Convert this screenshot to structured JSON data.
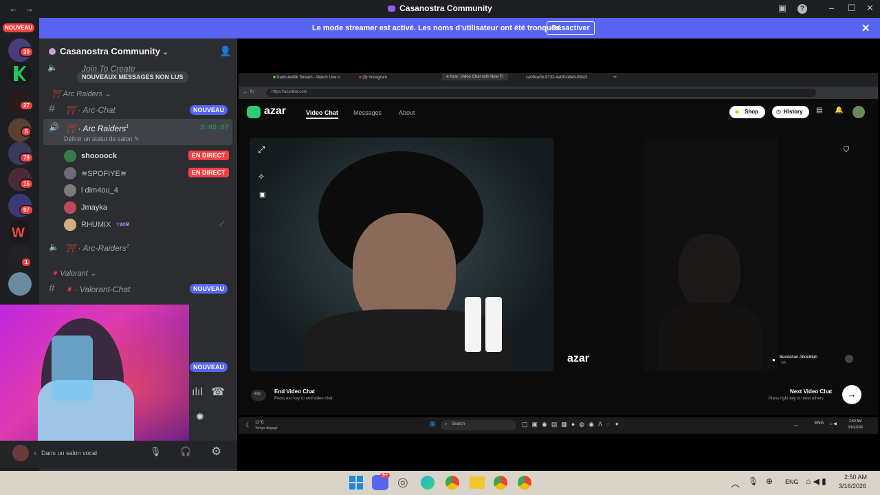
{
  "window": {
    "title": "Casanostra Community"
  },
  "banner": {
    "text": "Le mode streamer est activé. Les noms d’utilisateur ont été tronqués.",
    "button": "Désactiver"
  },
  "rail": {
    "nouveau": "NOUVEAU",
    "badges": [
      "30",
      "27",
      "5",
      "79",
      "15",
      "97",
      "1"
    ]
  },
  "sidebar": {
    "server_name": "Casanostra Community",
    "unread_pill": "NOUVEAUX MESSAGES NON LUS",
    "join_to_create": "Join To Create",
    "cat_arc": "Arc Raiders",
    "arc_chat": "Arc-Chat",
    "arc_chat_badge": "NOUVEAU",
    "voice_channel": "Arc Raiders",
    "voice_sup": "1",
    "voice_timer": "3:05:07",
    "voice_status": "Définir un statut de salon",
    "users": [
      {
        "name": "shoooock",
        "badge": "EN DIRECT"
      },
      {
        "name": "≋SPOFIYE≋",
        "badge": "EN DIRECT"
      },
      {
        "name": "l dim4ou_4",
        "badge": ""
      },
      {
        "name": "Jmayka",
        "badge": ""
      },
      {
        "name": "RHUMIX",
        "badge": ""
      }
    ],
    "arc_raiders2": "Arc-Raiders",
    "arc_raiders2_sup": "2",
    "cat_valorant": "Valorant",
    "valorant_chat": "Valorant-Chat",
    "valorant_badge": "NOUVEAU",
    "lower_badge": "NOUVEAU"
  },
  "userbar": {
    "status": "Dans un salon vocal"
  },
  "share": {
    "tabs": [
      "Nahouliel9k Stream - Watch Live o",
      "(9) Instagram",
      "Azar: Video Chat with New Fr",
      "ca09ca0b-9732-4a06-b8e9-0f8d3"
    ],
    "url": "https://azarlive.com",
    "azar": {
      "logo": "azar",
      "nav": [
        "Video Chat",
        "Messages",
        "About"
      ],
      "shop": "Shop",
      "history": "History",
      "watermark": "azar",
      "partner_name": "Bendahan Abdellilah",
      "partner_country": "MA",
      "esc_key": "esc",
      "end_title": "End Video Chat",
      "end_sub": "Press esc key to end video chat",
      "next_title": "Next Video Chat",
      "next_sub": "Press right key to meet others"
    },
    "weather": "11°C",
    "weather_sub": "Temps dégagé",
    "search": "Search",
    "lang": "ENG",
    "time": "2:50 AM",
    "date": "3/16/2026"
  },
  "taskbar": {
    "lang": "ENG",
    "time": "2:50 AM",
    "date": "3/16/2026",
    "discord_badge": "9+"
  }
}
